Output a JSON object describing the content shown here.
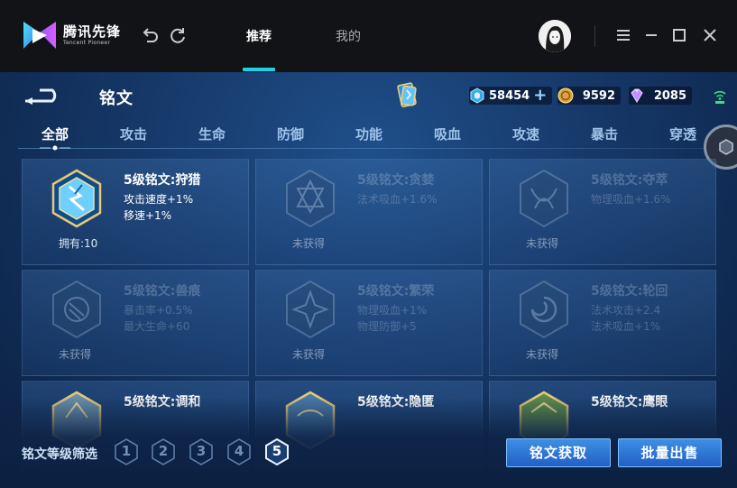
{
  "launcher": {
    "brand_name": "腾讯先锋",
    "brand_sub": "Tencent Pioneer",
    "tabs": [
      {
        "label": "推荐",
        "active": true
      },
      {
        "label": "我的",
        "active": false
      }
    ],
    "accent_color": "#19d2e6"
  },
  "game": {
    "title": "铭文",
    "currencies": [
      {
        "icon": "diamond-gem-icon",
        "value": "58454",
        "has_plus": true
      },
      {
        "icon": "gold-coin-icon",
        "value": "9592"
      },
      {
        "icon": "crystal-icon",
        "value": "2085"
      }
    ],
    "categories": [
      {
        "label": "全部",
        "active": true
      },
      {
        "label": "攻击"
      },
      {
        "label": "生命"
      },
      {
        "label": "防御"
      },
      {
        "label": "功能"
      },
      {
        "label": "吸血"
      },
      {
        "label": "攻速"
      },
      {
        "label": "暴击"
      },
      {
        "label": "穿透"
      }
    ],
    "cards": [
      {
        "name": "5级铭文:狩猎",
        "attrs": [
          "攻击速度+1%",
          "移速+1%"
        ],
        "status": "拥有:10",
        "owned": true
      },
      {
        "name": "5级铭文:贪婪",
        "attrs": [
          "法术吸血+1.6%"
        ],
        "status": "未获得",
        "owned": false
      },
      {
        "name": "5级铭文:夺萃",
        "attrs": [
          "物理吸血+1.6%"
        ],
        "status": "未获得",
        "owned": false
      },
      {
        "name": "5级铭文:兽痕",
        "attrs": [
          "暴击率+0.5%",
          "最大生命+60"
        ],
        "status": "未获得",
        "owned": false
      },
      {
        "name": "5级铭文:繁荣",
        "attrs": [
          "物理吸血+1%",
          "物理防御+5"
        ],
        "status": "未获得",
        "owned": false
      },
      {
        "name": "5级铭文:轮回",
        "attrs": [
          "法术攻击+2.4",
          "法术吸血+1%"
        ],
        "status": "未获得",
        "owned": false
      },
      {
        "name": "5级铭文:调和",
        "attrs": [],
        "status": "",
        "owned": true
      },
      {
        "name": "5级铭文:隐匿",
        "attrs": [],
        "status": "",
        "owned": true
      },
      {
        "name": "5级铭文:鹰眼",
        "attrs": [],
        "status": "",
        "owned": true
      }
    ],
    "filter_label": "铭文等级筛选",
    "levels": [
      "1",
      "2",
      "3",
      "4",
      "5"
    ],
    "active_level": "5",
    "buttons": {
      "obtain": "铭文获取",
      "bulk_sell": "批量出售"
    }
  }
}
